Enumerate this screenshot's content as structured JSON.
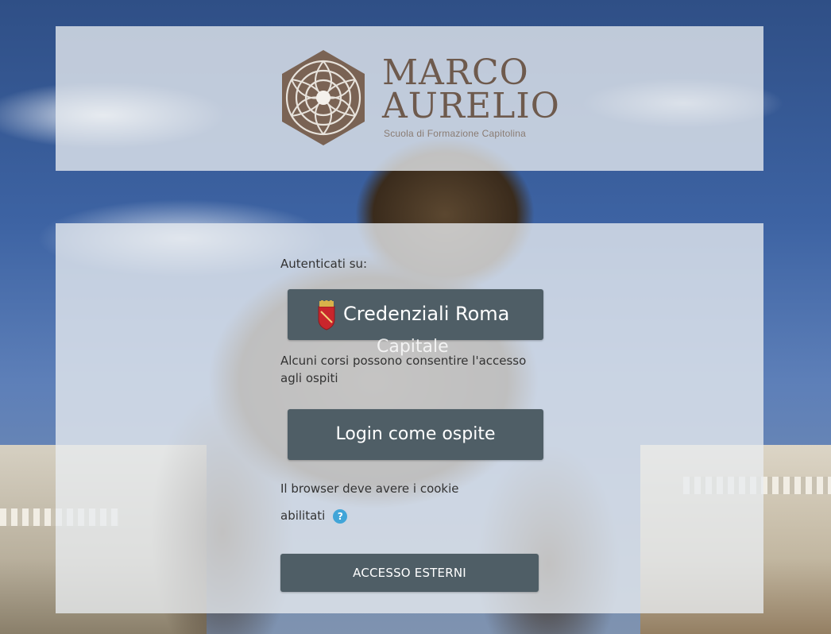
{
  "header": {
    "logo_title": "MARCO",
    "logo_title2": "AURELIO",
    "logo_subtitle": "Scuola di Formazione Capitolina"
  },
  "login": {
    "authenticate_label": "Autenticati su:",
    "roma_button_label": "Credenziali Roma",
    "roma_button_overflow": "Capitale",
    "guest_info": "Alcuni corsi possono consentire l'accesso agli ospiti",
    "guest_button_label": "Login come ospite",
    "cookie_info_line1": "Il browser deve avere i cookie",
    "cookie_info_line2": "abilitati",
    "help_icon_glyph": "?",
    "external_button_label": "ACCESSO ESTERNI"
  },
  "colors": {
    "button_bg": "#4f5e66",
    "logo_brown": "#6e5a4d",
    "help_blue": "#41a5d8"
  },
  "icons": {
    "crest": "roma-crest-icon",
    "help": "help-icon"
  }
}
